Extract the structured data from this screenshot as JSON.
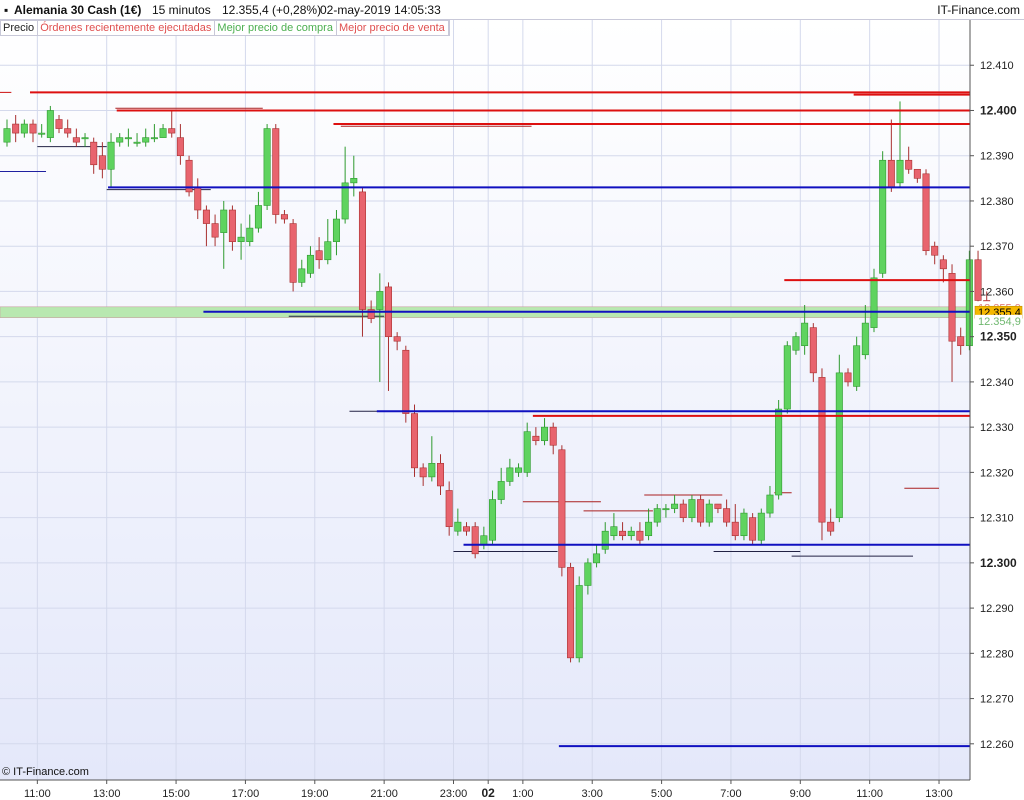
{
  "header": {
    "instrument": "Alemania 30 Cash (1€)",
    "timeframe": "15 minutos",
    "quote": "12.355,4 (+0,28%)",
    "datetime": "02-may-2019 14:05:33",
    "brand": "IT-Finance.com"
  },
  "legend": {
    "items": [
      {
        "label": "Precio",
        "color": "#222222"
      },
      {
        "label": "Órdenes recientemente ejecutadas",
        "color": "#e05050"
      },
      {
        "label": "Mejor precio de compra",
        "color": "#4caf50"
      },
      {
        "label": "Mejor precio de venta",
        "color": "#e05050"
      }
    ]
  },
  "footer": {
    "copyright": "© IT-Finance.com"
  },
  "colors": {
    "up": "#5fd35f",
    "up_border": "#2e9a2e",
    "down": "#e8646e",
    "down_border": "#a83030",
    "blue_line": "#1010c0",
    "red_line": "#dd1010",
    "grid": "#d4d9ec",
    "bg_top": "#ffffff",
    "bg_bottom": "#e6e9fb"
  },
  "chart_data": {
    "type": "candlestick",
    "y_range": [
      12.252,
      12.42
    ],
    "y_ticks": [
      {
        "value": 12.41,
        "label": "12.410",
        "bold": false
      },
      {
        "value": 12.4,
        "label": "12.400",
        "bold": true
      },
      {
        "value": 12.39,
        "label": "12.390",
        "bold": false
      },
      {
        "value": 12.38,
        "label": "12.380",
        "bold": false
      },
      {
        "value": 12.37,
        "label": "12.370",
        "bold": false
      },
      {
        "value": 12.36,
        "label": "12.360",
        "bold": false
      },
      {
        "value": 12.35,
        "label": "12.350",
        "bold": true
      },
      {
        "value": 12.34,
        "label": "12.340",
        "bold": false
      },
      {
        "value": 12.33,
        "label": "12.330",
        "bold": false
      },
      {
        "value": 12.32,
        "label": "12.320",
        "bold": false
      },
      {
        "value": 12.31,
        "label": "12.310",
        "bold": false
      },
      {
        "value": 12.3,
        "label": "12.300",
        "bold": true
      },
      {
        "value": 12.29,
        "label": "12.290",
        "bold": false
      },
      {
        "value": 12.28,
        "label": "12.280",
        "bold": false
      },
      {
        "value": 12.27,
        "label": "12.270",
        "bold": false
      },
      {
        "value": 12.26,
        "label": "12.260",
        "bold": false
      }
    ],
    "x_ticks": [
      {
        "bar": 3.5,
        "label": "11:00",
        "bold": false
      },
      {
        "bar": 11.5,
        "label": "13:00",
        "bold": false
      },
      {
        "bar": 19.5,
        "label": "15:00",
        "bold": false
      },
      {
        "bar": 27.5,
        "label": "17:00",
        "bold": false
      },
      {
        "bar": 35.5,
        "label": "19:00",
        "bold": false
      },
      {
        "bar": 43.5,
        "label": "21:00",
        "bold": false
      },
      {
        "bar": 51.5,
        "label": "23:00",
        "bold": false
      },
      {
        "bar": 55.5,
        "label": "02",
        "bold": true
      },
      {
        "bar": 59.5,
        "label": "1:00",
        "bold": false
      },
      {
        "bar": 67.5,
        "label": "3:00",
        "bold": false
      },
      {
        "bar": 75.5,
        "label": "5:00",
        "bold": false
      },
      {
        "bar": 83.5,
        "label": "7:00",
        "bold": false
      },
      {
        "bar": 91.5,
        "label": "9:00",
        "bold": false
      },
      {
        "bar": 99.5,
        "label": "11:00",
        "bold": false
      },
      {
        "bar": 107.5,
        "label": "13:00",
        "bold": false
      }
    ],
    "candles": [
      [
        12.393,
        12.396,
        12.398,
        12.392
      ],
      [
        12.397,
        12.395,
        12.399,
        12.393
      ],
      [
        12.395,
        12.397,
        12.398,
        12.394
      ],
      [
        12.397,
        12.395,
        12.398,
        12.393
      ],
      [
        12.395,
        12.395,
        12.397,
        12.394
      ],
      [
        12.394,
        12.4,
        12.401,
        12.393
      ],
      [
        12.398,
        12.396,
        12.399,
        12.395
      ],
      [
        12.396,
        12.395,
        12.398,
        12.394
      ],
      [
        12.394,
        12.393,
        12.396,
        12.392
      ],
      [
        12.394,
        12.394,
        12.395,
        12.392
      ],
      [
        12.393,
        12.388,
        12.394,
        12.386
      ],
      [
        12.39,
        12.387,
        12.393,
        12.385
      ],
      [
        12.387,
        12.393,
        12.395,
        12.383
      ],
      [
        12.393,
        12.394,
        12.395,
        12.392
      ],
      [
        12.394,
        12.394,
        12.396,
        12.392
      ],
      [
        12.393,
        12.393,
        12.395,
        12.392
      ],
      [
        12.393,
        12.394,
        12.396,
        12.392
      ],
      [
        12.394,
        12.394,
        12.397,
        12.393
      ],
      [
        12.394,
        12.396,
        12.397,
        12.394
      ],
      [
        12.396,
        12.395,
        12.4,
        12.394
      ],
      [
        12.394,
        12.39,
        12.397,
        12.388
      ],
      [
        12.389,
        12.382,
        12.39,
        12.381
      ],
      [
        12.383,
        12.378,
        12.385,
        12.376
      ],
      [
        12.378,
        12.375,
        12.379,
        12.37
      ],
      [
        12.375,
        12.372,
        12.377,
        12.37
      ],
      [
        12.373,
        12.378,
        12.38,
        12.365
      ],
      [
        12.378,
        12.371,
        12.379,
        12.369
      ],
      [
        12.371,
        12.372,
        12.375,
        12.367
      ],
      [
        12.371,
        12.374,
        12.377,
        12.37
      ],
      [
        12.374,
        12.379,
        12.382,
        12.373
      ],
      [
        12.379,
        12.396,
        12.397,
        12.378
      ],
      [
        12.396,
        12.377,
        12.397,
        12.375
      ],
      [
        12.377,
        12.376,
        12.378,
        12.375
      ],
      [
        12.375,
        12.362,
        12.376,
        12.36
      ],
      [
        12.362,
        12.365,
        12.367,
        12.361
      ],
      [
        12.364,
        12.368,
        12.37,
        12.363
      ],
      [
        12.369,
        12.367,
        12.372,
        12.365
      ],
      [
        12.367,
        12.371,
        12.376,
        12.366
      ],
      [
        12.371,
        12.376,
        12.378,
        12.368
      ],
      [
        12.376,
        12.384,
        12.392,
        12.375
      ],
      [
        12.384,
        12.385,
        12.39,
        12.381
      ],
      [
        12.382,
        12.356,
        12.383,
        12.35
      ],
      [
        12.356,
        12.354,
        12.358,
        12.353
      ],
      [
        12.356,
        12.36,
        12.364,
        12.34
      ],
      [
        12.361,
        12.35,
        12.362,
        12.338
      ],
      [
        12.35,
        12.349,
        12.351,
        12.347
      ],
      [
        12.347,
        12.333,
        12.348,
        12.331
      ],
      [
        12.333,
        12.321,
        12.335,
        12.319
      ],
      [
        12.321,
        12.319,
        12.322,
        12.317
      ],
      [
        12.319,
        12.322,
        12.328,
        12.318
      ],
      [
        12.322,
        12.317,
        12.324,
        12.315
      ],
      [
        12.316,
        12.308,
        12.318,
        12.306
      ],
      [
        12.307,
        12.309,
        12.312,
        12.306
      ],
      [
        12.308,
        12.307,
        12.309,
        12.306
      ],
      [
        12.308,
        12.302,
        12.309,
        12.301
      ],
      [
        12.304,
        12.306,
        12.308,
        12.303
      ],
      [
        12.305,
        12.314,
        12.316,
        12.304
      ],
      [
        12.314,
        12.318,
        12.321,
        12.313
      ],
      [
        12.318,
        12.321,
        12.323,
        12.317
      ],
      [
        12.32,
        12.321,
        12.322,
        12.319
      ],
      [
        12.32,
        12.329,
        12.331,
        12.319
      ],
      [
        12.328,
        12.327,
        12.33,
        12.326
      ],
      [
        12.327,
        12.33,
        12.332,
        12.326
      ],
      [
        12.33,
        12.326,
        12.331,
        12.324
      ],
      [
        12.325,
        12.299,
        12.326,
        12.297
      ],
      [
        12.299,
        12.279,
        12.3,
        12.278
      ],
      [
        12.279,
        12.295,
        12.297,
        12.278
      ],
      [
        12.295,
        12.3,
        12.301,
        12.293
      ],
      [
        12.3,
        12.302,
        12.304,
        12.299
      ],
      [
        12.303,
        12.307,
        12.309,
        12.302
      ],
      [
        12.306,
        12.308,
        12.311,
        12.305
      ],
      [
        12.307,
        12.306,
        12.309,
        12.305
      ],
      [
        12.306,
        12.307,
        12.308,
        12.305
      ],
      [
        12.307,
        12.305,
        12.309,
        12.304
      ],
      [
        12.306,
        12.309,
        12.312,
        12.305
      ],
      [
        12.309,
        12.312,
        12.313,
        12.308
      ],
      [
        12.312,
        12.312,
        12.313,
        12.31
      ],
      [
        12.312,
        12.313,
        12.315,
        12.311
      ],
      [
        12.313,
        12.31,
        12.314,
        12.309
      ],
      [
        12.31,
        12.314,
        12.315,
        12.309
      ],
      [
        12.314,
        12.309,
        12.315,
        12.308
      ],
      [
        12.309,
        12.313,
        12.314,
        12.308
      ],
      [
        12.313,
        12.312,
        12.313,
        12.311
      ],
      [
        12.312,
        12.309,
        12.314,
        12.308
      ],
      [
        12.309,
        12.306,
        12.313,
        12.305
      ],
      [
        12.306,
        12.311,
        12.312,
        12.305
      ],
      [
        12.31,
        12.305,
        12.311,
        12.304
      ],
      [
        12.305,
        12.311,
        12.312,
        12.304
      ],
      [
        12.311,
        12.315,
        12.317,
        12.31
      ],
      [
        12.315,
        12.334,
        12.336,
        12.314
      ],
      [
        12.334,
        12.348,
        12.349,
        12.333
      ],
      [
        12.347,
        12.35,
        12.351,
        12.346
      ],
      [
        12.348,
        12.353,
        12.357,
        12.346
      ],
      [
        12.352,
        12.342,
        12.353,
        12.34
      ],
      [
        12.341,
        12.309,
        12.343,
        12.305
      ],
      [
        12.309,
        12.307,
        12.312,
        12.306
      ],
      [
        12.31,
        12.342,
        12.346,
        12.309
      ],
      [
        12.342,
        12.34,
        12.343,
        12.339
      ],
      [
        12.339,
        12.348,
        12.35,
        12.338
      ],
      [
        12.346,
        12.353,
        12.357,
        12.345
      ],
      [
        12.352,
        12.363,
        12.365,
        12.351
      ],
      [
        12.364,
        12.389,
        12.391,
        12.363
      ],
      [
        12.389,
        12.383,
        12.398,
        12.382
      ],
      [
        12.384,
        12.389,
        12.402,
        12.383
      ],
      [
        12.389,
        12.387,
        12.392,
        12.386
      ],
      [
        12.387,
        12.385,
        12.387,
        12.384
      ],
      [
        12.386,
        12.369,
        12.387,
        12.368
      ],
      [
        12.37,
        12.368,
        12.371,
        12.366
      ],
      [
        12.367,
        12.365,
        12.368,
        12.362
      ],
      [
        12.364,
        12.349,
        12.366,
        12.34
      ],
      [
        12.35,
        12.348,
        12.352,
        12.346
      ],
      [
        12.348,
        12.367,
        12.369,
        12.347
      ],
      [
        12.367,
        12.358,
        12.369,
        12.357
      ],
      [
        12.358,
        12.355,
        12.36,
        12.354
      ]
    ],
    "resistance_lines": [
      {
        "bar": 3,
        "value": 12.404
      },
      {
        "bar": 13,
        "value": 12.4
      },
      {
        "bar": 38,
        "value": 12.397
      },
      {
        "bar": 98,
        "value": 12.4035
      },
      {
        "bar": 90,
        "value": 12.3625
      },
      {
        "bar": 61,
        "value": 12.3325
      }
    ],
    "support_lines": [
      {
        "bar": 12,
        "value": 12.383
      },
      {
        "bar": 23,
        "value": 12.3555
      },
      {
        "bar": 43,
        "value": 12.3335
      },
      {
        "bar": 53,
        "value": 12.304
      },
      {
        "bar": 64,
        "value": 12.2595
      }
    ],
    "order_lines": [
      {
        "x0": -1,
        "x1": 0.5,
        "value": 12.404,
        "color": "#cc1010"
      },
      {
        "x0": -1,
        "x1": 4.5,
        "value": 12.3865,
        "color": "#2020a0"
      },
      {
        "x0": 3.5,
        "x1": 11.5,
        "value": 12.392,
        "color": "#222244"
      },
      {
        "x0": 11.5,
        "x1": 23.5,
        "value": 12.3825,
        "color": "#222244"
      },
      {
        "x0": 12.5,
        "x1": 29.5,
        "value": 12.4005,
        "color": "#aa2020"
      },
      {
        "x0": 32.5,
        "x1": 43.5,
        "value": 12.3545,
        "color": "#222244"
      },
      {
        "x0": 38.5,
        "x1": 60.5,
        "value": 12.3965,
        "color": "#aa2020"
      },
      {
        "x0": 39.5,
        "x1": 46.5,
        "value": 12.3335,
        "color": "#222244"
      },
      {
        "x0": 51.5,
        "x1": 63.5,
        "value": 12.3025,
        "color": "#222244"
      },
      {
        "x0": 59.5,
        "x1": 68.5,
        "value": 12.3135,
        "color": "#aa2020"
      },
      {
        "x0": 66.5,
        "x1": 74.5,
        "value": 12.3115,
        "color": "#aa2020"
      },
      {
        "x0": 73.5,
        "x1": 82.5,
        "value": 12.315,
        "color": "#aa2020"
      },
      {
        "x0": 81.5,
        "x1": 91.5,
        "value": 12.3025,
        "color": "#222244"
      },
      {
        "x0": 88.5,
        "x1": 90.5,
        "value": 12.3155,
        "color": "#aa2020"
      },
      {
        "x0": 90.5,
        "x1": 104.5,
        "value": 12.3015,
        "color": "#222244"
      },
      {
        "x0": 95.5,
        "x1": 98.5,
        "value": 12.3625,
        "color": "#aa2020"
      },
      {
        "x0": 103.5,
        "x1": 107.5,
        "value": 12.3165,
        "color": "#aa2020"
      }
    ],
    "bid_band": {
      "low": 12.3542,
      "high": 12.3566
    },
    "price_labels": [
      {
        "text": "12.355,9",
        "value": 12.3565,
        "fill": "#ffffff",
        "textColor": "#e08080"
      },
      {
        "text": "12.355,4",
        "value": 12.3554,
        "fill": "#f5b800",
        "textColor": "#000000"
      },
      {
        "text": "12.354,9",
        "value": 12.3535,
        "fill": "#ffffff",
        "textColor": "#70b870"
      }
    ]
  }
}
